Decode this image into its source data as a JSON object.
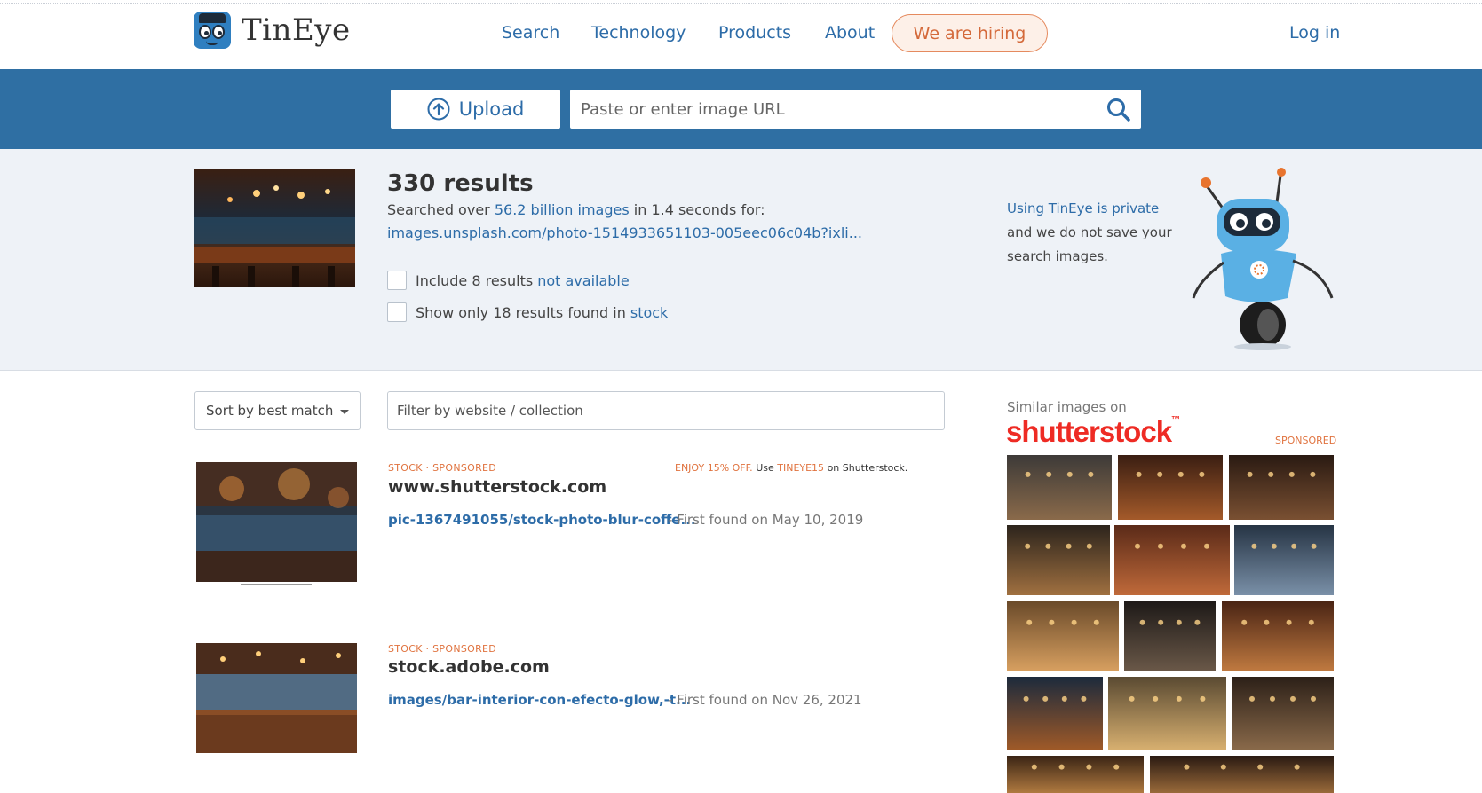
{
  "header": {
    "logo_text": "TinEye",
    "nav": [
      "Search",
      "Technology",
      "Products",
      "About"
    ],
    "hiring": "We are hiring",
    "login": "Log in"
  },
  "search": {
    "upload_label": "Upload",
    "url_placeholder": "Paste or enter image URL"
  },
  "summary": {
    "count": "330 results",
    "searched_prefix": "Searched over",
    "searched_link": "56.2 billion images",
    "searched_suffix": "in 1.4 seconds for:",
    "query_url": "images.unsplash.com/photo-1514933651103-005eec06c04b?ixli...",
    "check1_text": "Include 8 results",
    "check1_link": "not available",
    "check2_text": "Show only 18 results found in",
    "check2_link": "stock",
    "privacy_link": "Using TinEye is private",
    "privacy_text": "and we do not save your search images."
  },
  "controls": {
    "sort_label": "Sort by best match",
    "filter_placeholder": "Filter by website / collection"
  },
  "results": [
    {
      "tags": "STOCK · SPONSORED",
      "promo_orange": "ENJOY 15% OFF.",
      "promo_use": "Use",
      "promo_code": "TINEYE15",
      "promo_suffix": "on Shutterstock.",
      "site": "www.shutterstock.com",
      "path": "pic-1367491055/stock-photo-blur-coffe...",
      "found": "- First found on May 10, 2019"
    },
    {
      "tags": "STOCK · SPONSORED",
      "site": "stock.adobe.com",
      "path": "images/bar-interior-con-efecto-glow,-t...",
      "found": "- First found on Nov 26, 2021"
    }
  ],
  "sidebar": {
    "similar_title": "Similar images on",
    "brand": "shutterstock",
    "sponsored": "SPONSORED"
  },
  "colors": {
    "accent": "#2f6fa3",
    "link": "#2d6ca8",
    "orange": "#e0733f",
    "brand_red": "#ee2b24"
  }
}
